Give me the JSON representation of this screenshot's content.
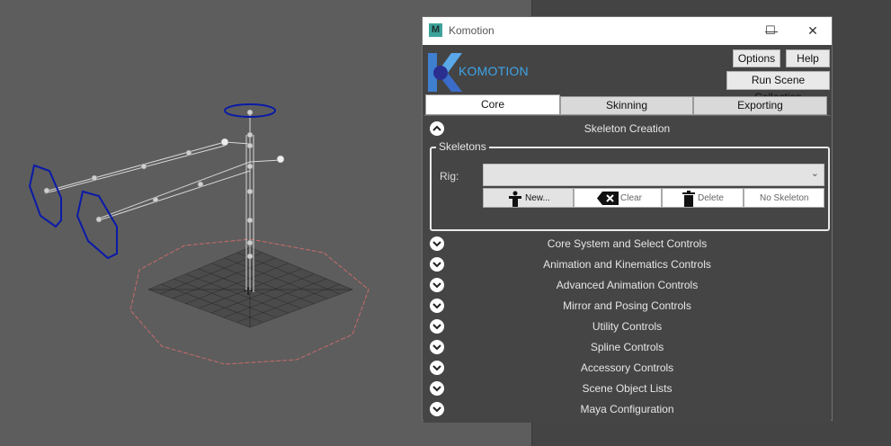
{
  "window": {
    "title": "Komotion",
    "app_icon_letter": "M",
    "logo_text": "KOMOTION",
    "controls": {
      "minimize": "—",
      "maximize": "☐",
      "close": "✕"
    }
  },
  "header_buttons": {
    "options": "Options",
    "help": "Help",
    "run_scene": "Run Scene Collection"
  },
  "tabs": [
    {
      "label": "Core",
      "active": true
    },
    {
      "label": "Skinning",
      "active": false
    },
    {
      "label": "Exporting",
      "active": false
    }
  ],
  "skeleton_creation": {
    "title": "Skeleton Creation",
    "group_title": "Skeletons",
    "rig_label": "Rig:",
    "rig_value": "",
    "buttons": {
      "new": "New...",
      "clear": "Clear",
      "delete": "Delete",
      "no_skeleton": "No Skeleton"
    }
  },
  "sections": [
    "Core System and Select Controls",
    "Animation and Kinematics Controls",
    "Advanced Animation Controls",
    "Mirror and Posing Controls",
    "Utility Controls",
    "Spline Controls",
    "Accessory Controls",
    "Scene Object Lists",
    "Maya Configuration"
  ],
  "colors": {
    "logo_blue": "#3fa4e8",
    "viewport_bg": "#5d5d5d",
    "panel_bg": "#454545",
    "controller_blue": "#0a1aa8",
    "ground_red": "#c96b6b"
  }
}
